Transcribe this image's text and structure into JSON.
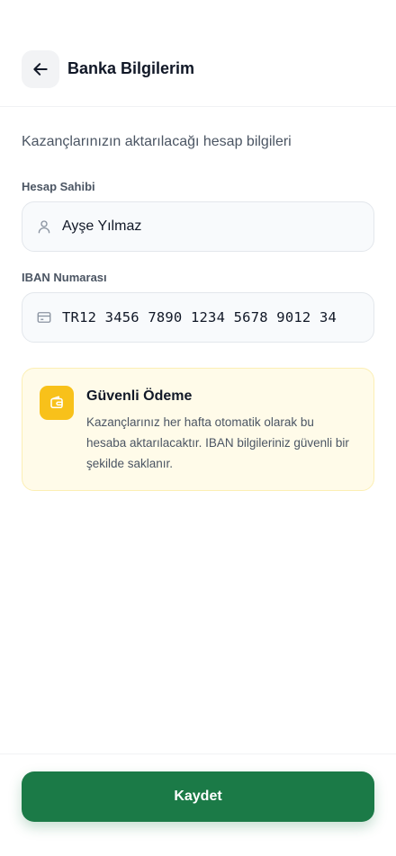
{
  "header": {
    "title": "Banka Bilgilerim",
    "back_icon": "arrow-left-icon"
  },
  "subtitle": "Kazançlarınızın aktarılacağı hesap bilgileri",
  "account_holder": {
    "label": "Hesap Sahibi",
    "value": "Ayşe Yılmaz",
    "icon": "user-icon"
  },
  "iban": {
    "label": "IBAN Numarası",
    "value": "TR12 3456 7890 1234 5678 9012 34",
    "icon": "card-icon"
  },
  "info_card": {
    "title": "Güvenli Ödeme",
    "text": "Kazançlarınız her hafta otomatik olarak bu hesaba aktarılacaktır. IBAN bilgileriniz güvenli bir şekilde saklanır.",
    "icon": "wallet-icon",
    "accent_color": "#f8c11a"
  },
  "footer": {
    "save_label": "Kaydet",
    "button_color": "#1b7a47"
  }
}
